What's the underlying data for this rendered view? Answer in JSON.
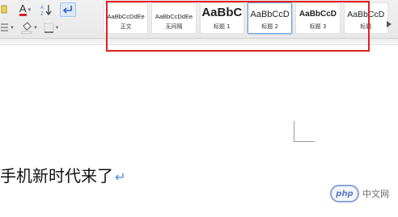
{
  "toolbar": {
    "row1": [
      {
        "id": "font-color",
        "label": "A",
        "has_dropdown": true
      },
      {
        "id": "font-effects",
        "label": "A",
        "has_dropdown": true
      },
      {
        "id": "sort",
        "label": "A Z",
        "icon": "sort-icon"
      },
      {
        "id": "show-marks",
        "icon": "pilcrow-return-icon"
      }
    ],
    "row2": [
      {
        "id": "list",
        "icon": "list-icon",
        "has_dropdown": true
      },
      {
        "id": "shading",
        "icon": "paint-bucket-icon",
        "has_dropdown": true
      },
      {
        "id": "borders",
        "icon": "borders-icon",
        "has_dropdown": true
      }
    ]
  },
  "styles_gallery": {
    "items": [
      {
        "sample": "AaBbCcDdEe",
        "name": "正文",
        "selected": false
      },
      {
        "sample": "AaBbCcDdEe",
        "name": "无间隔",
        "selected": false
      },
      {
        "sample": "AaBbC",
        "name": "标题 1",
        "selected": false
      },
      {
        "sample": "AaBbCcD",
        "name": "标题 2",
        "selected": true
      },
      {
        "sample": "AaBbCcD",
        "name": "标题 3",
        "selected": false
      },
      {
        "sample": "AaBbCcD",
        "name": "标题",
        "selected": false
      }
    ],
    "more_icon": "chevron-right-icon",
    "highlight_color": "#e02020"
  },
  "document": {
    "text": "手机新时代来了",
    "paragraph_mark": "↵"
  },
  "watermark": {
    "logo_text": "php",
    "text": "中文网"
  }
}
